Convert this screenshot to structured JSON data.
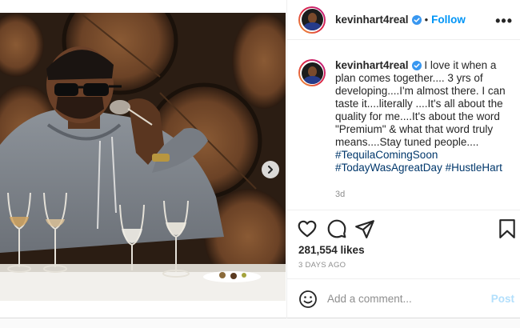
{
  "post": {
    "username": "kevinhart4real",
    "separator": "•",
    "follow_label": "Follow",
    "more_label": "•••",
    "caption": {
      "username": "kevinhart4real",
      "text": "I love it when a plan comes together.... 3 yrs of developing....I'm almost there. I can taste it....literally ....It's all about the quality for me....It's about the word \"Premium\" & what that word truly means....Stay tuned people....",
      "hashtags": [
        "#TequilaComingSoon",
        "#TodayWasAgreatDay",
        "#HustleHart"
      ]
    },
    "age": "3d",
    "likes": "281,554 likes",
    "date": "3 DAYS AGO",
    "comment": {
      "placeholder": "Add a comment...",
      "post_label": "Post"
    },
    "colors": {
      "accent": "#0095f6",
      "hashtag": "#00376b",
      "muted": "#8e8e8e",
      "post_disabled": "#b2dffc"
    },
    "icons": [
      "verified-badge-icon",
      "more-options-icon",
      "carousel-next-icon",
      "heart-icon",
      "comment-icon",
      "share-icon",
      "bookmark-icon",
      "emoji-icon"
    ]
  }
}
